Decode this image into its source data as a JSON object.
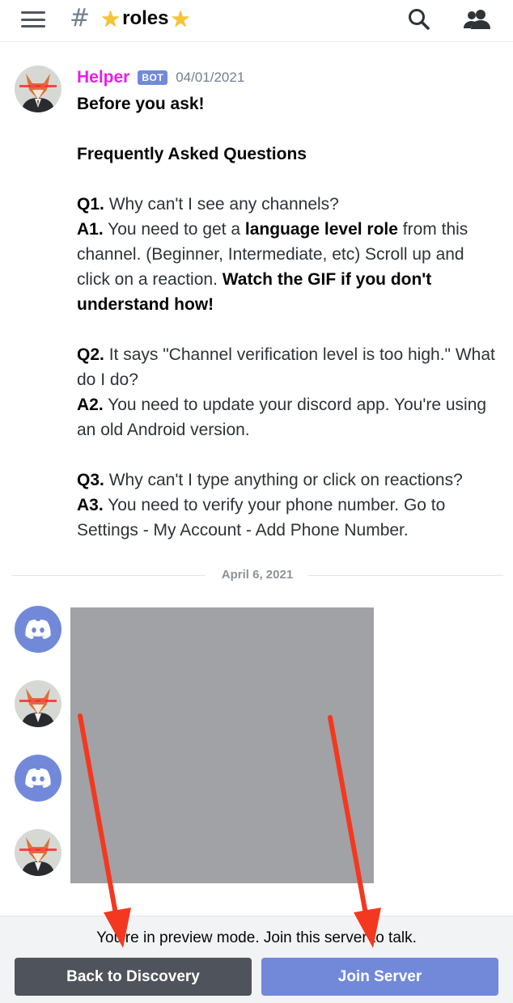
{
  "header": {
    "menu_icon": "hamburger-menu-icon",
    "channel_prefix": "#",
    "channel_name": "roles",
    "emoji": "star",
    "search_icon": "search-icon",
    "members_icon": "members-icon"
  },
  "message": {
    "author": "Helper",
    "badge": "BOT",
    "timestamp": "04/01/2021",
    "author_color": "#e91eea",
    "lines": {
      "l1": "Before you ask!",
      "l2": "Frequently Asked Questions",
      "q1_label": "Q1.",
      "q1_text": " Why can't I see any channels?",
      "a1_label": "A1.",
      "a1_text_1": " You need to get a ",
      "a1_bold": "language level role",
      "a1_text_2": " from this channel. (Beginner, Intermediate, etc) Scroll up and click on a reaction. ",
      "a1_bold_2": "Watch the GIF if you don't understand how!",
      "q2_label": "Q2.",
      "q2_text": " It says \"Channel verification level is too high.\" What do I do?",
      "a2_label": "A2.",
      "a2_text": " You need to update your discord app. You're using an old Android version.",
      "q3_label": "Q3.",
      "q3_text": " Why can't I type anything or click on reactions?",
      "a3_label": "A3.",
      "a3_text": " You need to verify your phone number. Go to Settings - My Account - Add Phone Number."
    }
  },
  "divider": {
    "date": "April 6, 2021"
  },
  "footer": {
    "preview_text": "You're in preview mode. Join this server to talk.",
    "back_button": "Back to Discovery",
    "join_button": "Join Server"
  },
  "colors": {
    "blurple": "#7289da",
    "dark_button": "#4f545c",
    "arrow": "#f4381f"
  }
}
